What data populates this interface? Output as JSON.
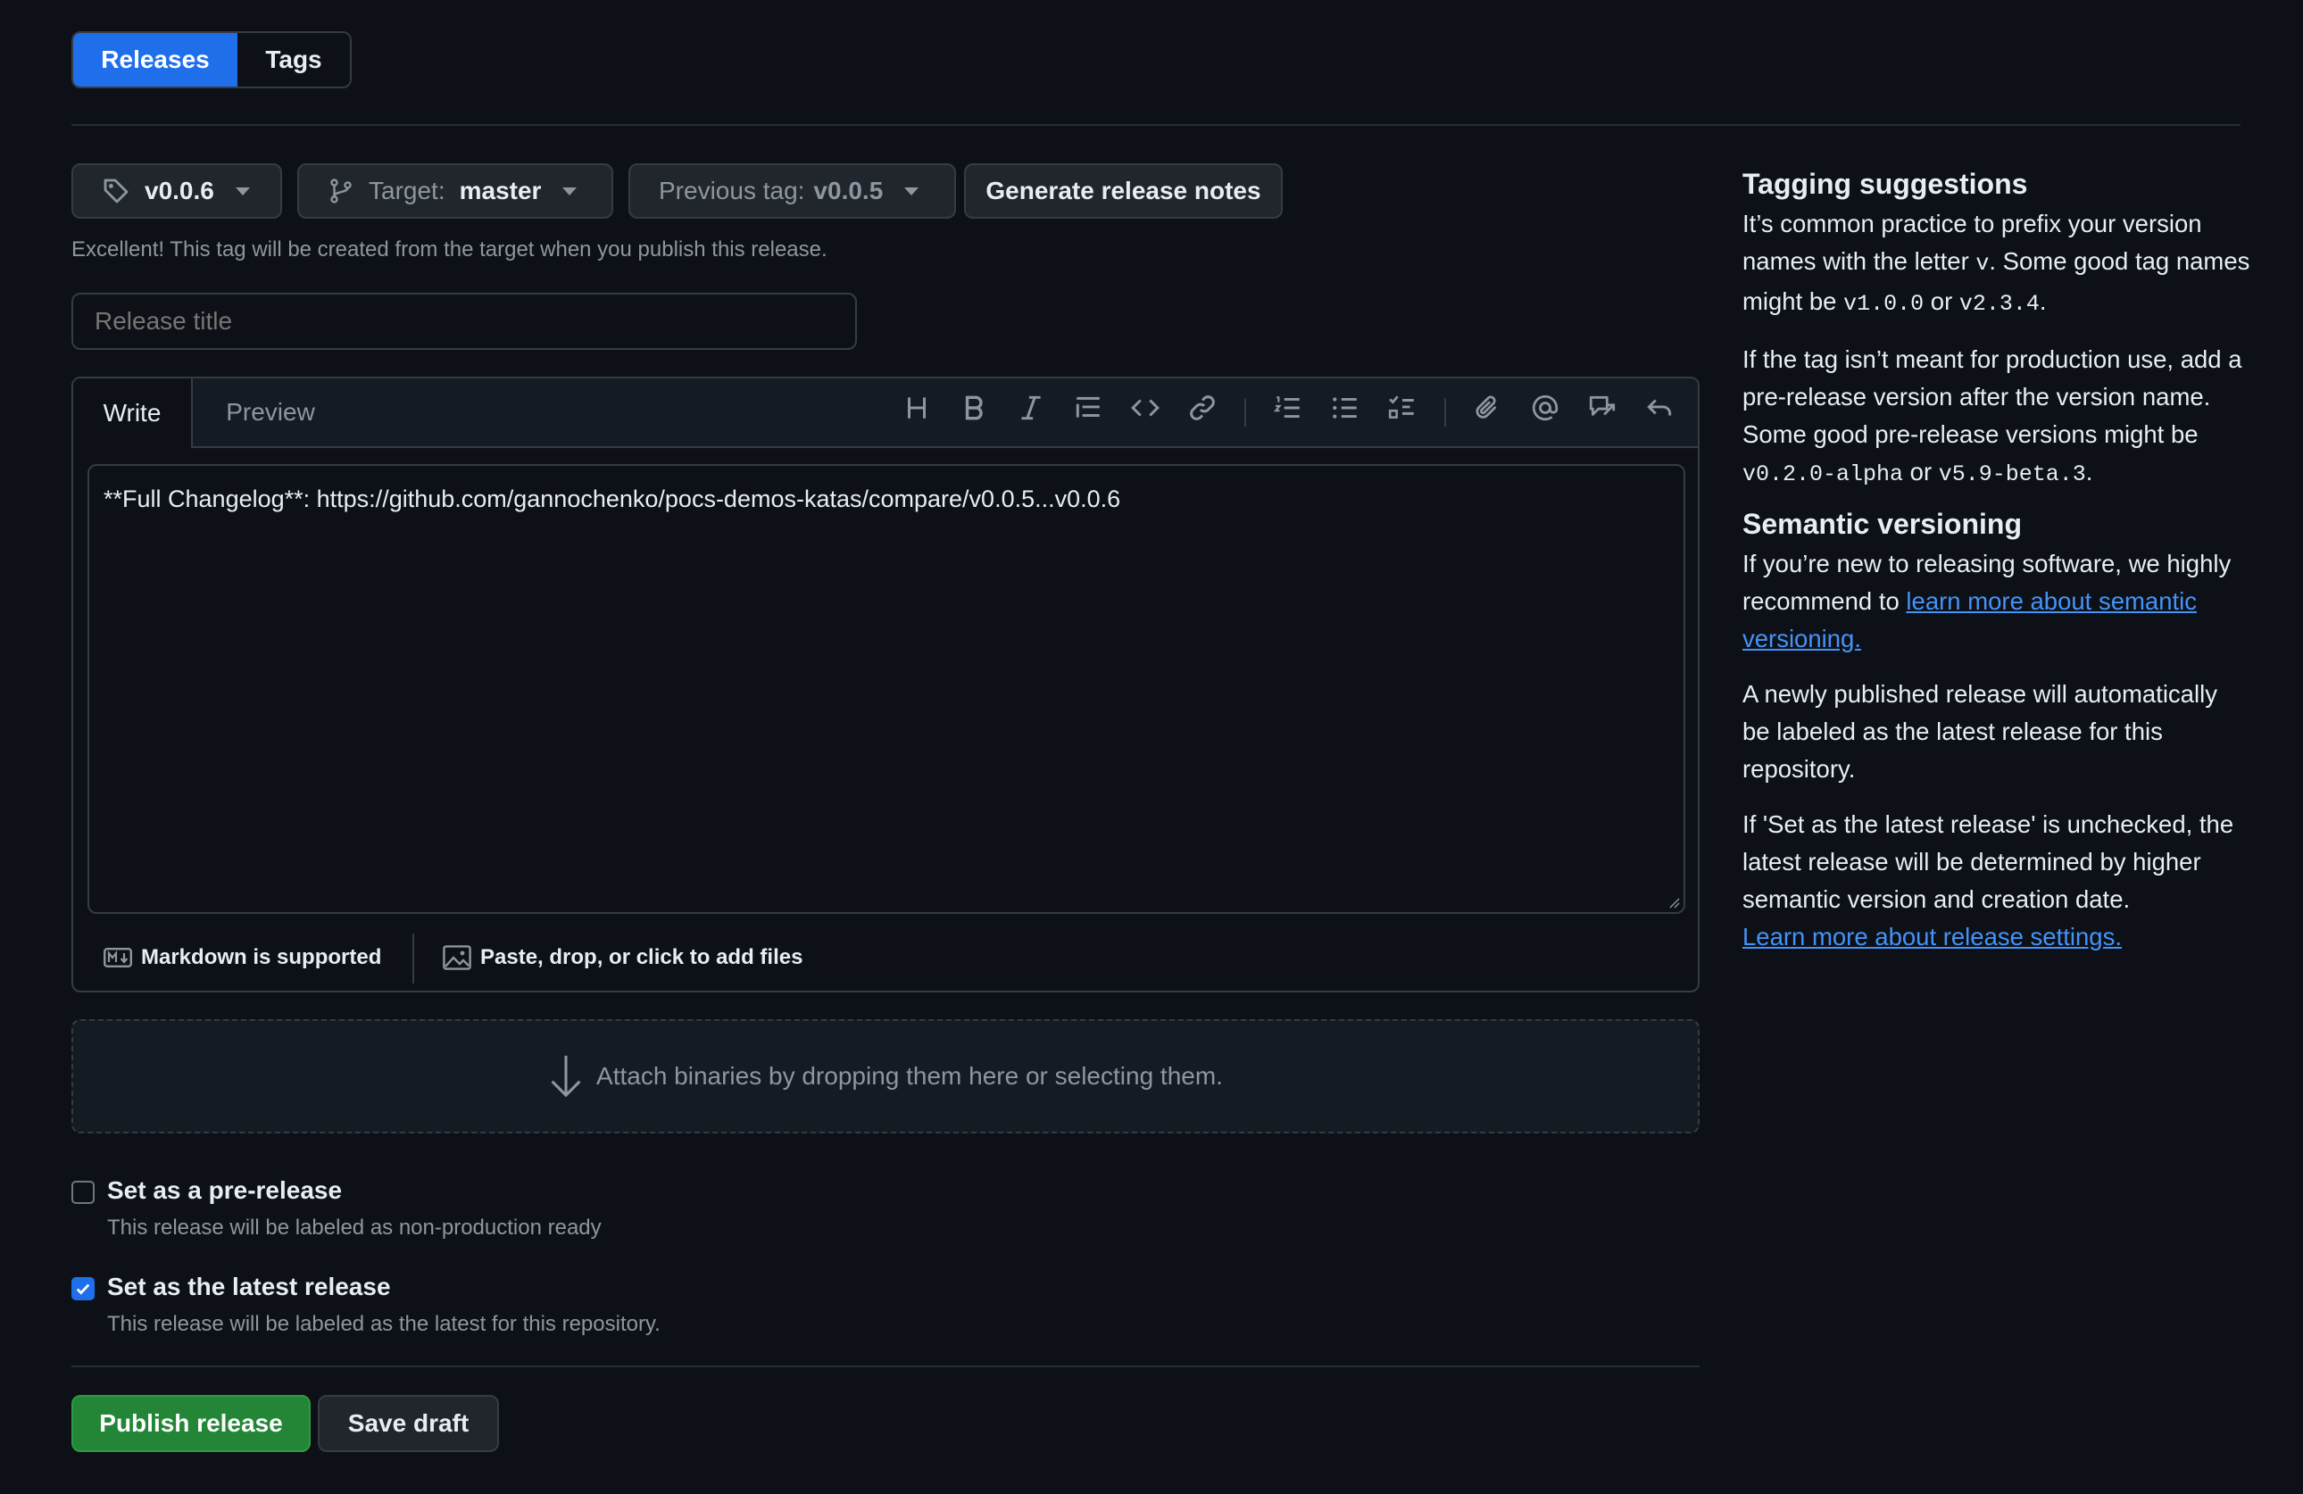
{
  "nav": {
    "releases_label": "Releases",
    "tags_label": "Tags"
  },
  "controls": {
    "tag_value": "v0.0.6",
    "target_prefix": "Target:",
    "target_value": "master",
    "previous_tag_label": "Previous tag:",
    "previous_tag_value": "v0.0.5",
    "generate_notes_label": "Generate release notes",
    "tag_hint": "Excellent! This tag will be created from the target when you publish this release."
  },
  "title_input": {
    "placeholder": "Release title",
    "value": ""
  },
  "editor": {
    "tab_write": "Write",
    "tab_preview": "Preview",
    "body_text": "**Full Changelog**: https://github.com/gannochenko/pocs-demos-katas/compare/v0.0.5...v0.0.6",
    "markdown_note": "Markdown is supported",
    "files_note": "Paste, drop, or click to add files",
    "toolbar_icons": [
      "heading-icon",
      "bold-icon",
      "italic-icon",
      "quote-icon",
      "code-icon",
      "link-icon",
      "ordered-list-icon",
      "unordered-list-icon",
      "task-list-icon",
      "attachment-icon",
      "mention-icon",
      "reference-icon",
      "undo-icon"
    ]
  },
  "attach": {
    "label": "Attach binaries by dropping them here or selecting them."
  },
  "options": {
    "prerelease_label": "Set as a pre-release",
    "prerelease_desc": "This release will be labeled as non-production ready",
    "prerelease_checked": false,
    "latest_label": "Set as the latest release",
    "latest_desc": "This release will be labeled as the latest for this repository.",
    "latest_checked": true
  },
  "actions": {
    "publish_label": "Publish release",
    "save_draft_label": "Save draft"
  },
  "sidebar": {
    "tagging_heading": "Tagging suggestions",
    "tagging_p1_a": "It’s common practice to prefix your version names with the letter ",
    "tagging_p1_code1": "v",
    "tagging_p1_b": ". Some good tag names might be ",
    "tagging_p1_code2": "v1.0.0",
    "tagging_p1_c": " or ",
    "tagging_p1_code3": "v2.3.4",
    "tagging_p1_d": ".",
    "tagging_p2_a": "If the tag isn’t meant for production use, add a pre-release version after the version name. Some good pre-release versions might be ",
    "tagging_p2_code1": "v0.2.0-alpha",
    "tagging_p2_b": " or ",
    "tagging_p2_code2": "v5.9-beta.3",
    "tagging_p2_c": ".",
    "semver_heading": "Semantic versioning",
    "semver_p1_a": "If you’re new to releasing software, we highly recommend to ",
    "semver_p1_link": "learn more about semantic versioning.",
    "semver_p2": "A newly published release will automatically be labeled as the latest release for this repository.",
    "semver_p3": "If 'Set as the latest release' is unchecked, the latest release will be determined by higher semantic version and creation date.",
    "semver_p3_link": "Learn more about release settings."
  },
  "colors": {
    "primary_blue": "#1f6feb",
    "publish_green": "#238636",
    "link": "#4493f8",
    "background": "#0d1117"
  }
}
